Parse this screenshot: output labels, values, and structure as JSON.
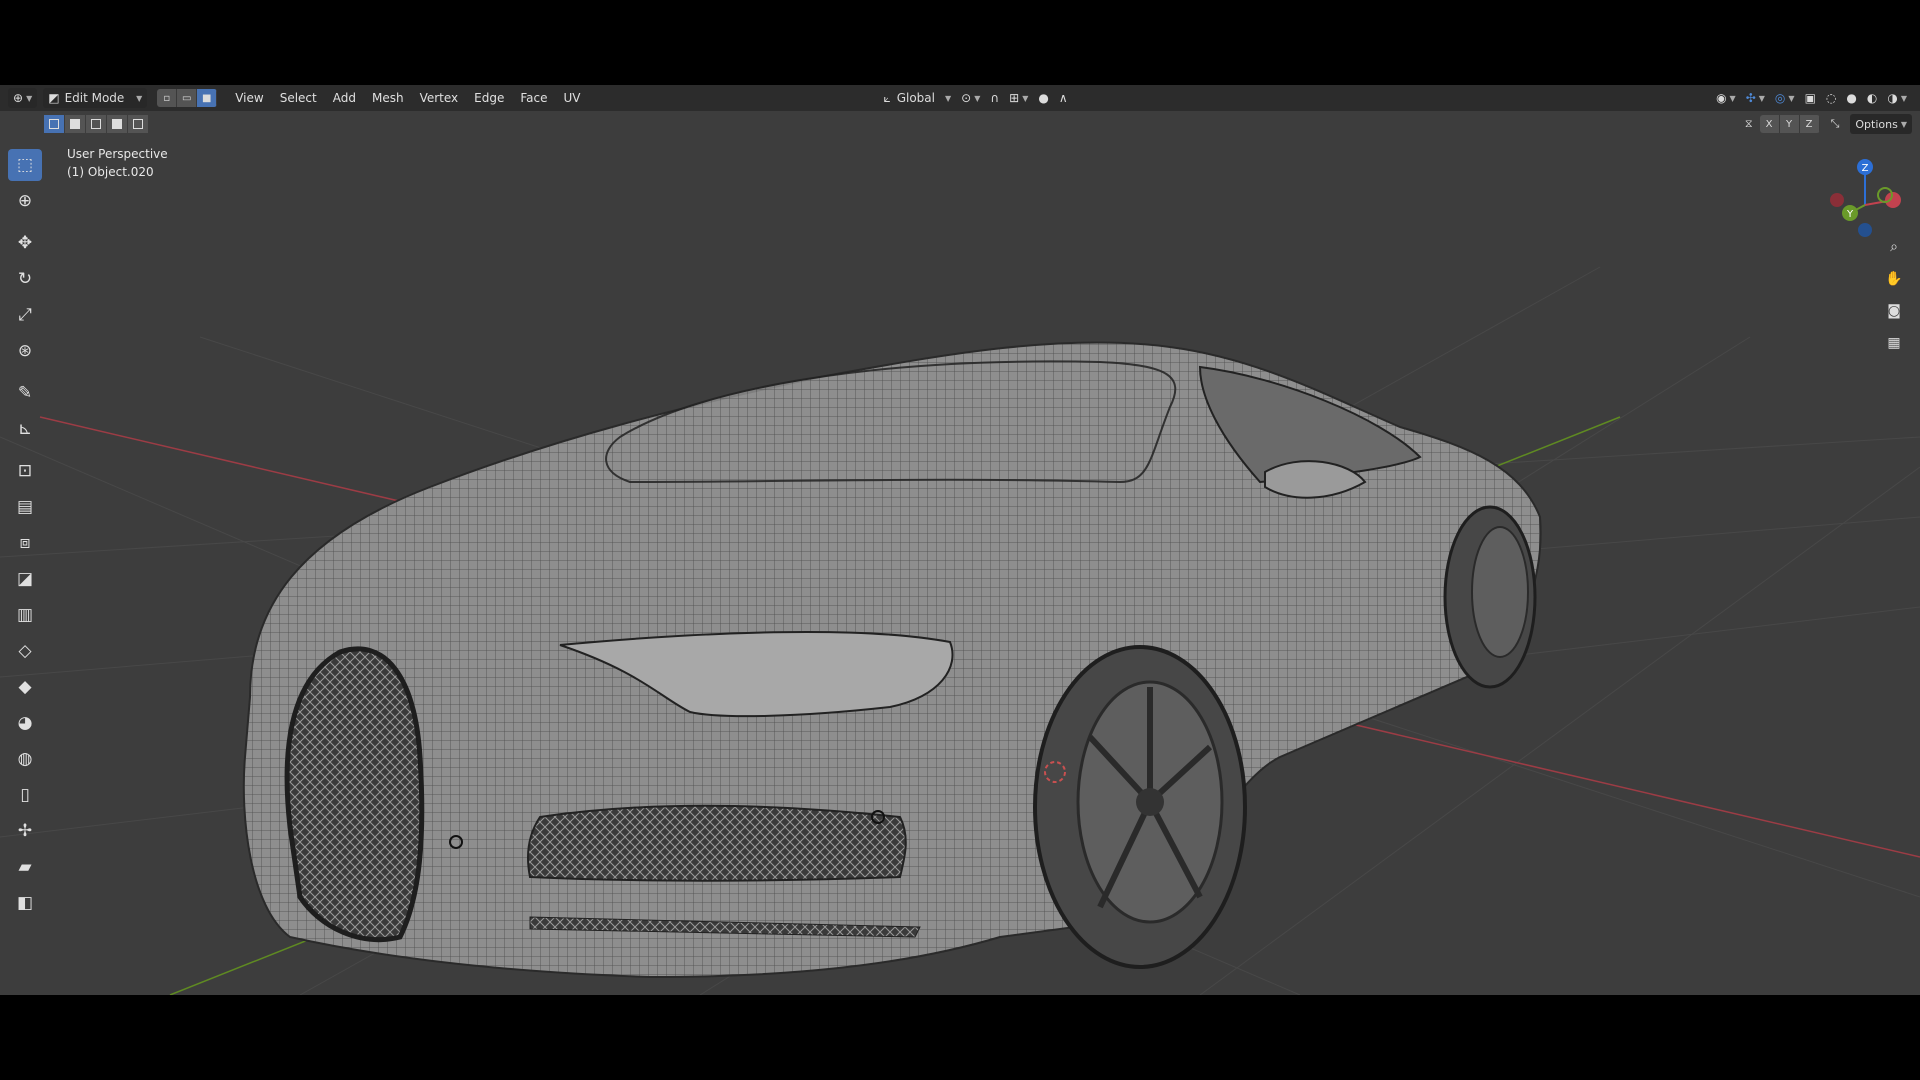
{
  "header": {
    "editor_icon": "3d-viewport-icon",
    "mode_label": "Edit Mode",
    "menus": [
      "View",
      "Select",
      "Add",
      "Mesh",
      "Vertex",
      "Edge",
      "Face",
      "UV"
    ],
    "transform_orientation": "Global",
    "options_label": "Options",
    "axes": [
      "X",
      "Y",
      "Z"
    ]
  },
  "overlay": {
    "view_name": "User Perspective",
    "object_name": "(1) Object.020"
  },
  "toolbar": {
    "tools": [
      "select-box-icon",
      "cursor-icon",
      "move-icon",
      "rotate-icon",
      "scale-icon",
      "transform-icon",
      "annotate-icon",
      "measure-icon",
      "add-cube-icon",
      "extrude-icon",
      "inset-icon",
      "bevel-icon",
      "loop-cut-icon",
      "knife-icon",
      "poly-build-icon",
      "spin-icon",
      "smooth-icon",
      "edge-slide-icon",
      "shrink-fatten-icon",
      "shear-icon",
      "rip-icon"
    ]
  },
  "gizmo": {
    "axes": [
      "Z",
      "Y",
      "X"
    ]
  },
  "colors": {
    "accent": "#4772b3",
    "background": "#3d3d3d",
    "header": "#2c2c2c",
    "x_axis": "#c2424f",
    "y_axis": "#6a9a2a",
    "z_axis": "#2c6fd6"
  }
}
